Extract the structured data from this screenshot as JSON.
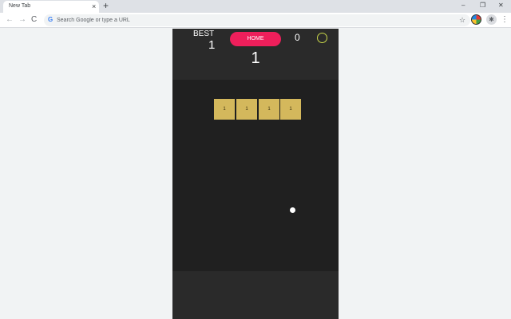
{
  "browser": {
    "tab_title": "New Tab",
    "tab_close": "×",
    "new_tab": "+",
    "window_controls": [
      "–",
      "❐",
      "✕"
    ],
    "nav": {
      "back": "←",
      "forward": "→",
      "reload": "C"
    },
    "omnibox_placeholder": "Search Google or type a URL",
    "g_letter": "G",
    "star": "☆",
    "menu": "⋮",
    "puzzle": "✱"
  },
  "game": {
    "best_label": "BEST",
    "best_value": "1",
    "home_label": "HOME",
    "coins": "0",
    "score": "1",
    "blocks": [
      "1",
      "1",
      "1",
      "1"
    ],
    "colors": {
      "background": "#2a2a2a",
      "field": "#202020",
      "home_button": "#ee1f5b",
      "block": "#d4b85c",
      "ring": "#c8d64a",
      "ball": "#ffffff"
    }
  }
}
